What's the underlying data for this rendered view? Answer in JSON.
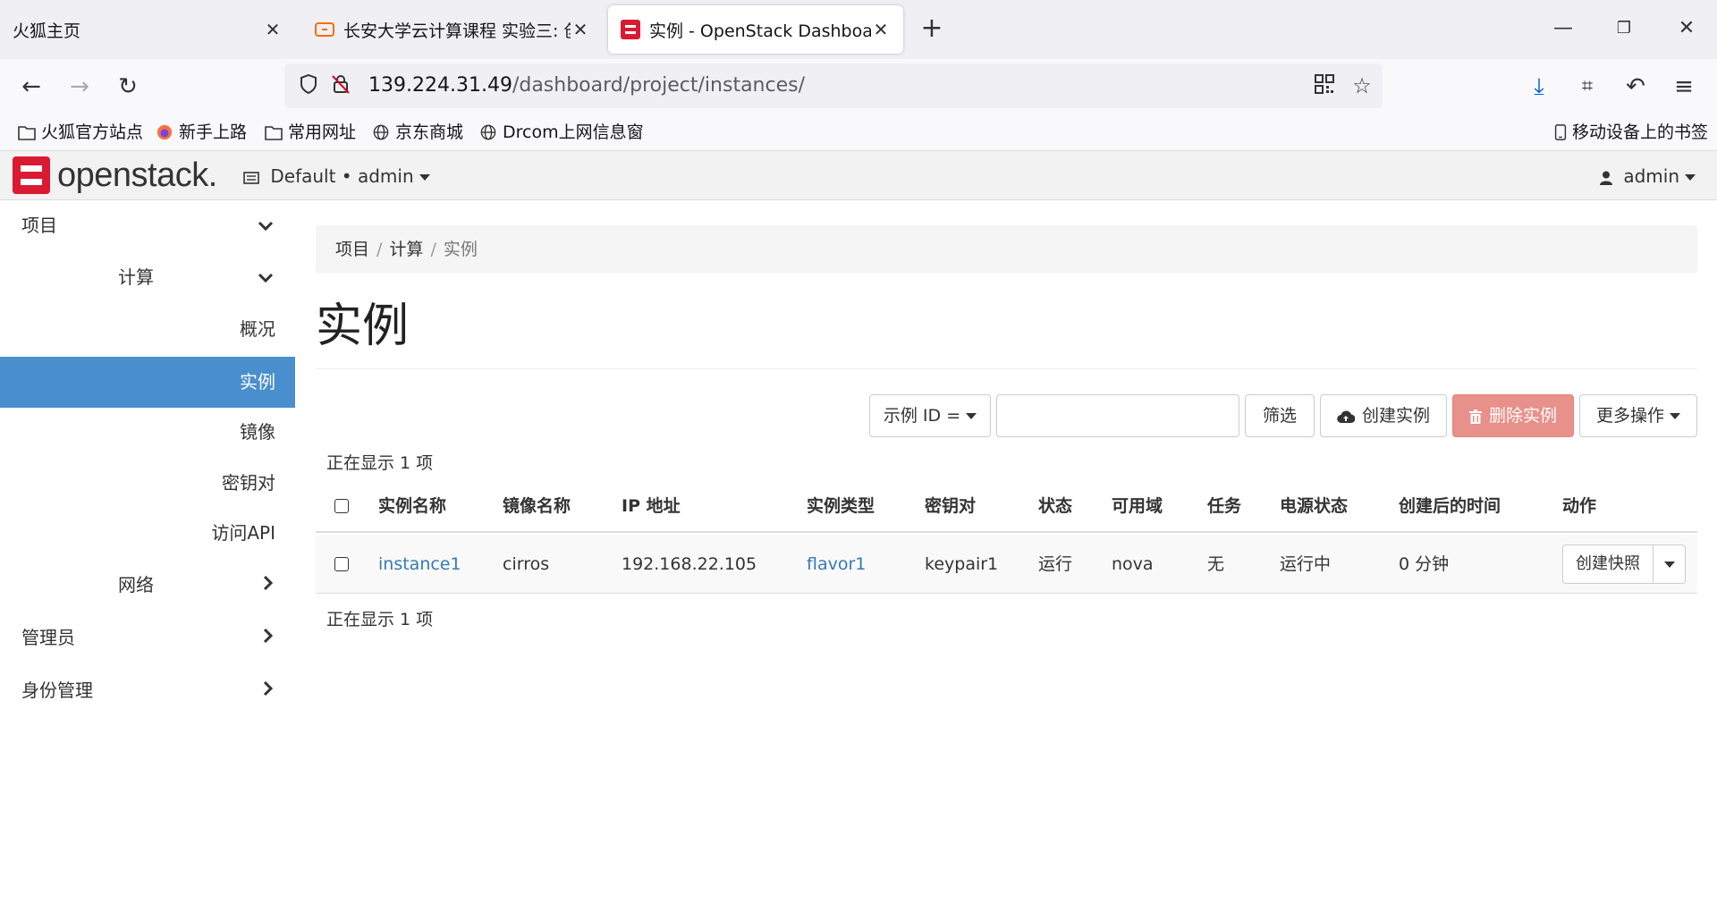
{
  "browser": {
    "tabs": [
      {
        "label": "火狐主页",
        "active": false
      },
      {
        "label": "长安大学云计算课程 实验三: 创",
        "active": false
      },
      {
        "label": "实例 - OpenStack Dashboard",
        "active": true
      }
    ],
    "url_host": "139.224.31.49",
    "url_path": "/dashboard/project/instances/",
    "bookmarks": [
      "火狐官方站点",
      "新手上路",
      "常用网址",
      "京东商城",
      "Drcom上网信息窗"
    ],
    "mobile_bookmarks": "移动设备上的书签"
  },
  "header": {
    "logo_text": "openstack.",
    "project_selector": "Default • admin",
    "user": "admin"
  },
  "sidebar": {
    "project": "项目",
    "compute": "计算",
    "items": [
      "概况",
      "实例",
      "镜像",
      "密钥对",
      "访问API"
    ],
    "network": "网络",
    "admin": "管理员",
    "identity": "身份管理"
  },
  "breadcrumb": {
    "level1": "项目",
    "level2": "计算",
    "current": "实例"
  },
  "page_title": "实例",
  "toolbar": {
    "filter_field": "示例 ID =",
    "filter_value": "",
    "filter_btn": "筛选",
    "create_btn": "创建实例",
    "delete_btn": "删除实例",
    "more_btn": "更多操作"
  },
  "count_text": "正在显示 1 项",
  "table": {
    "headers": [
      "实例名称",
      "镜像名称",
      "IP 地址",
      "实例类型",
      "密钥对",
      "状态",
      "可用域",
      "任务",
      "电源状态",
      "创建后的时间",
      "动作"
    ],
    "rows": [
      {
        "name": "instance1",
        "image": "cirros",
        "ip": "192.168.22.105",
        "flavor": "flavor1",
        "keypair": "keypair1",
        "status": "运行",
        "zone": "nova",
        "task": "无",
        "power": "运行中",
        "age": "0 分钟",
        "action": "创建快照"
      }
    ]
  },
  "colors": {
    "accent": "#4a8fcd",
    "danger": "#e8908a",
    "link": "#337ab7",
    "logo_red": "#da1a32"
  }
}
